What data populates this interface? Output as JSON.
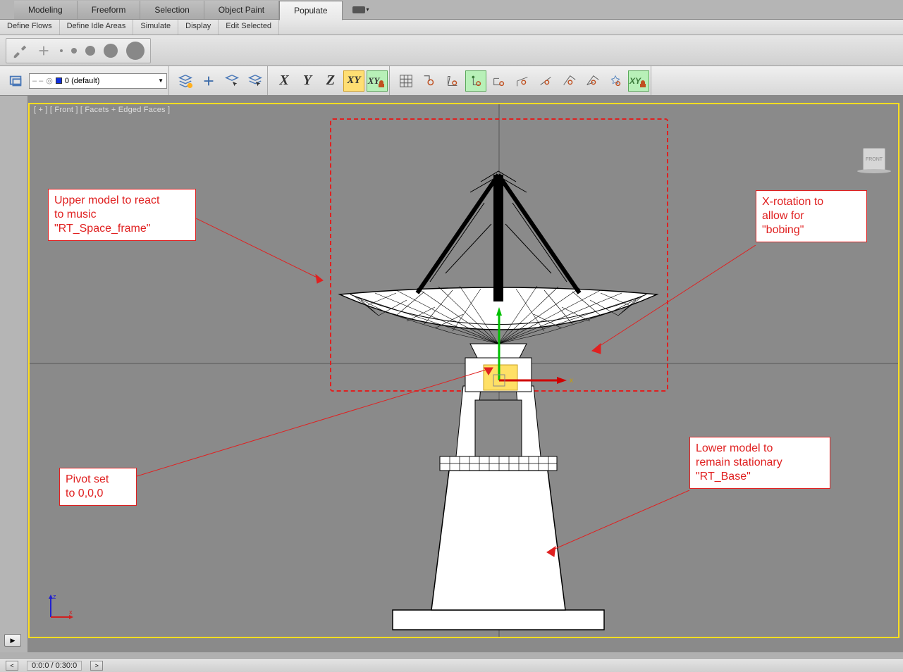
{
  "ribbon": {
    "tabs": [
      "Modeling",
      "Freeform",
      "Selection",
      "Object Paint",
      "Populate"
    ],
    "active": 4
  },
  "subtabs": [
    "Define Flows",
    "Define Idle Areas",
    "Simulate",
    "Display",
    "Edit Selected"
  ],
  "layer": {
    "label": "0 (default)"
  },
  "axes": {
    "x": "X",
    "y": "Y",
    "z": "Z",
    "xy": "XY",
    "xy2": "XY"
  },
  "snap_xy": "XY",
  "viewport": {
    "label": "[ + ] [ Front ] [ Facets + Edged Faces ]",
    "viewcube_face": "FRONT",
    "gizmo": {
      "x_label": "x",
      "z_label": "z",
      "world_x": "x"
    }
  },
  "annotations": {
    "upper": "Upper model to react\nto music\n\"RT_Space_frame\"",
    "xrot": "X-rotation to\nallow for\n\"bobing\"",
    "pivot": "Pivot set\nto 0,0,0",
    "lower": "Lower model to\nremain stationary\n\"RT_Base\""
  },
  "timeline": {
    "time": "0:0:0 / 0:30:0"
  }
}
